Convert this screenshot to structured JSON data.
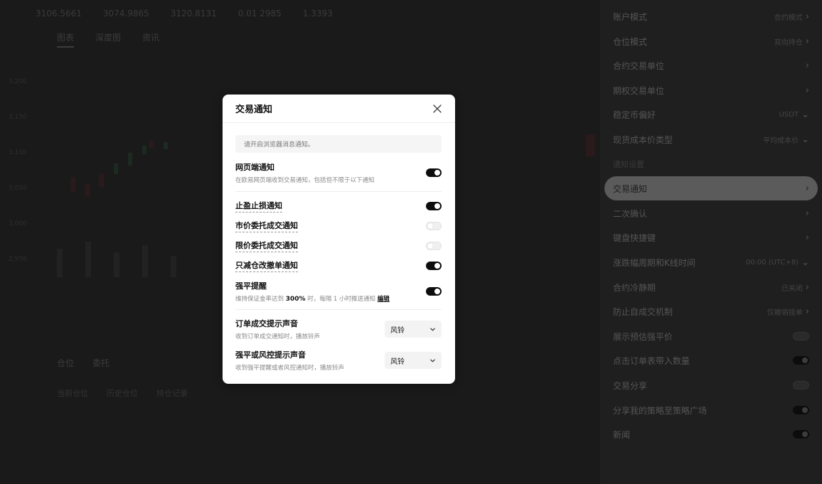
{
  "background": {
    "topbar": [
      "3106.5661",
      "3074.9865",
      "3120.8131",
      "0.01 2985",
      "1.3393"
    ],
    "tabs": [
      "图表",
      "深度图",
      "资讯"
    ],
    "axis": [
      "3,200",
      "3,150",
      "3,100",
      "3,050",
      "3,000",
      "2,950"
    ],
    "lower_tabs": [
      "仓位",
      "委托"
    ],
    "lower_tabs2": [
      "当前仓位",
      "历史仓位",
      "持仓记录"
    ]
  },
  "settings_panel": {
    "rows": [
      {
        "label": "账户模式",
        "value": "合约模式",
        "type": "link"
      },
      {
        "label": "仓位模式",
        "value": "双向持仓",
        "type": "link"
      },
      {
        "label": "合约交易单位",
        "value": "",
        "type": "link"
      },
      {
        "label": "期权交易单位",
        "value": "",
        "type": "link"
      },
      {
        "label": "稳定币偏好",
        "value": "USDT",
        "type": "dropdown"
      },
      {
        "label": "现货成本价类型",
        "value": "平均成本价",
        "type": "dropdown"
      },
      {
        "label": "通知设置",
        "value": "",
        "type": "section"
      },
      {
        "label": "交易通知",
        "value": "",
        "type": "link",
        "highlight": true
      },
      {
        "label": "二次确认",
        "value": "",
        "type": "link"
      },
      {
        "label": "键盘快捷键",
        "value": "",
        "type": "link"
      },
      {
        "label": "涨跌幅周期和K线时间",
        "value": "00:00 (UTC+8)",
        "type": "dropdown"
      },
      {
        "label": "合约冷静期",
        "value": "已关闭",
        "type": "link"
      },
      {
        "label": "防止自成交机制",
        "value": "仅撤销挂单",
        "type": "link"
      },
      {
        "label": "展示预估强平价",
        "value": "",
        "type": "toggle",
        "on": false
      },
      {
        "label": "点击订单表带入数量",
        "value": "",
        "type": "toggle",
        "on": true
      },
      {
        "label": "交易分享",
        "value": "",
        "type": "toggle",
        "on": false
      },
      {
        "label": "分享我的策略至策略广场",
        "value": "",
        "type": "toggle",
        "on": true
      },
      {
        "label": "新闻",
        "value": "",
        "type": "toggle",
        "on": true
      }
    ]
  },
  "modal": {
    "title": "交易通知",
    "notice": "请开启浏览器消息通知。",
    "web_notify": {
      "title": "网页端通知",
      "desc": "在欧易网页端收到交易通知，包括但不限于以下通知",
      "on": true
    },
    "items": [
      {
        "title": "止盈止损通知",
        "on": true
      },
      {
        "title": "市价委托成交通知",
        "on": false
      },
      {
        "title": "限价委托成交通知",
        "on": false
      },
      {
        "title": "只减仓改撤单通知",
        "on": true
      }
    ],
    "liquidation": {
      "title": "强平提醒",
      "desc_prefix": "维持保证金率达到",
      "ratio": "300%",
      "desc_suffix": "时，每隔 1 小时推送通知",
      "edit_label": "编辑",
      "on": true
    },
    "sound_order": {
      "title": "订单成交提示声音",
      "desc": "收到订单成交通知时，播放铃声",
      "value": "风铃"
    },
    "sound_risk": {
      "title": "强平或风控提示声音",
      "desc": "收到强平提醒或者风控通知时，播放铃声",
      "value": "风铃"
    }
  }
}
